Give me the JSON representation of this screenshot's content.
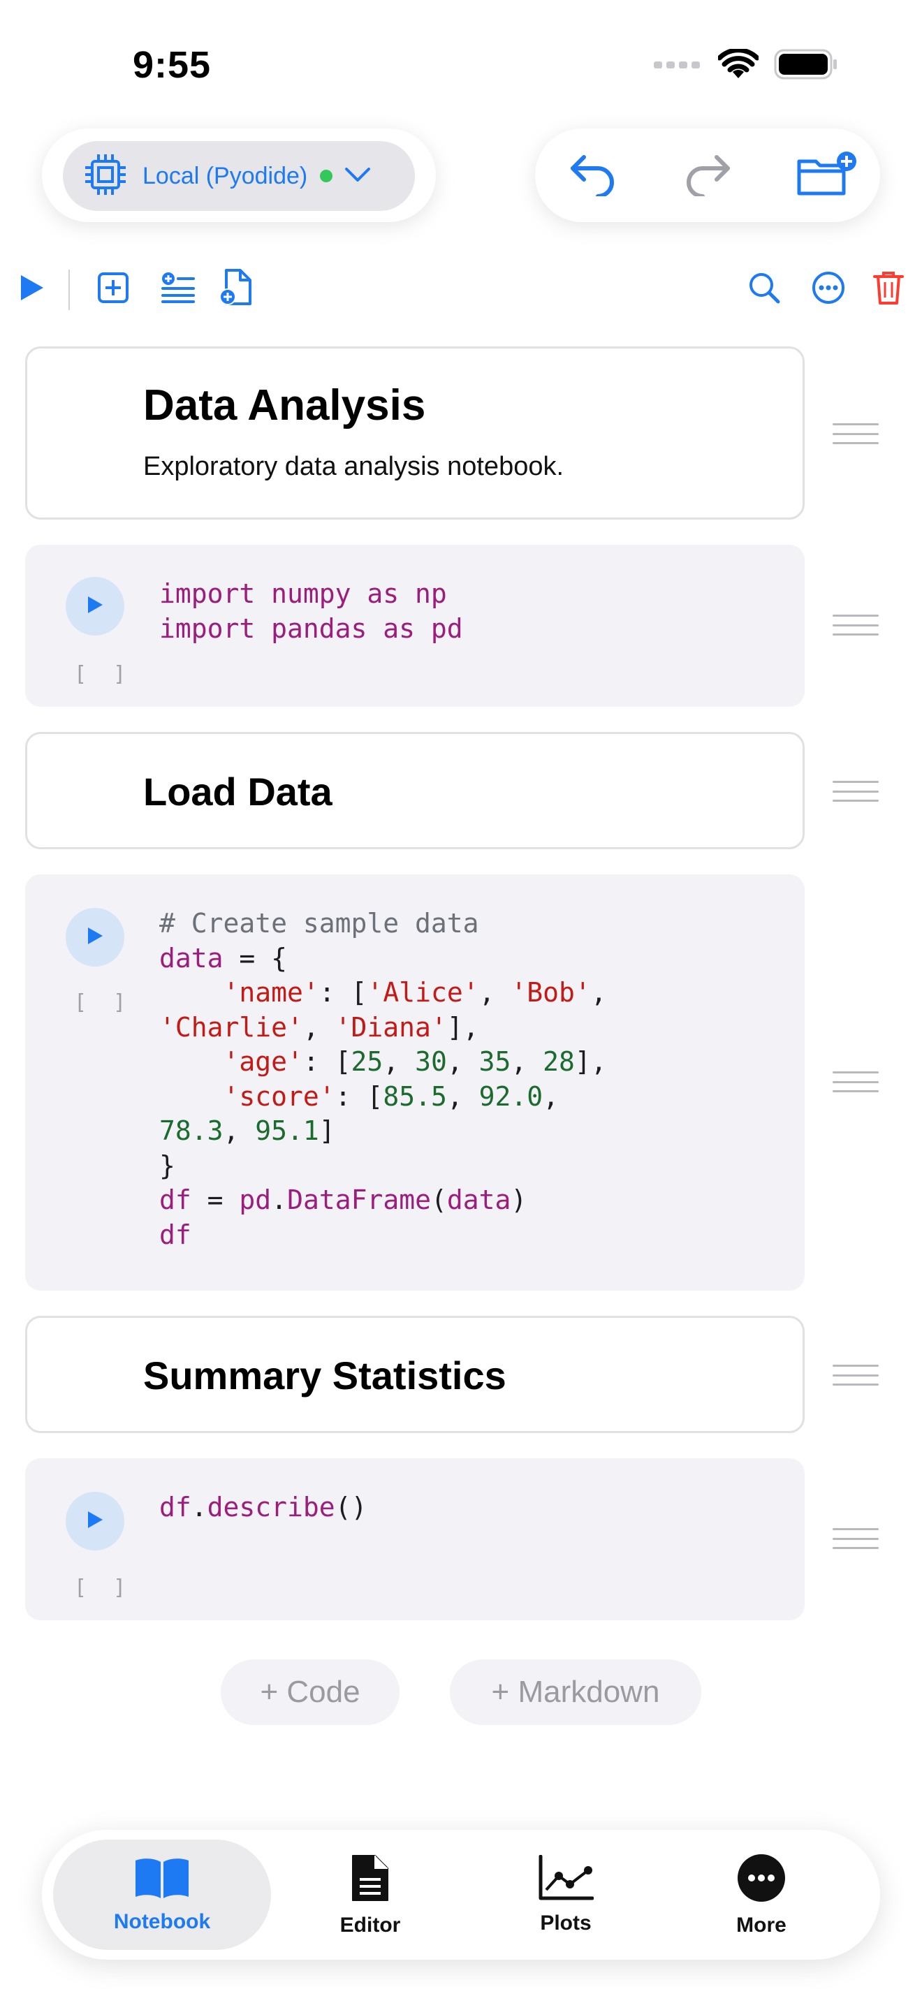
{
  "status": {
    "time": "9:55"
  },
  "kernel": {
    "label": "Local (Pyodide)",
    "status_color": "#34c759"
  },
  "nav": {
    "icons": [
      "undo-icon",
      "redo-icon",
      "new-folder-icon"
    ]
  },
  "toolbar": {
    "icons": [
      "run-all-icon",
      "add-code-cell-icon",
      "add-markdown-cell-icon",
      "new-notebook-icon",
      "search-icon",
      "more-options-icon",
      "delete-icon"
    ]
  },
  "cells": [
    {
      "type": "markdown",
      "heading": "Data Analysis",
      "paragraph": "Exploratory data analysis notebook."
    },
    {
      "type": "code",
      "exec": "[ ]",
      "lines": [
        "import numpy as np",
        "import pandas as pd"
      ]
    },
    {
      "type": "markdown",
      "heading": "Load Data"
    },
    {
      "type": "code",
      "exec": "[ ]",
      "lines": [
        "# Create sample data",
        "data = {",
        "    'name': ['Alice', 'Bob',",
        "'Charlie', 'Diana'],",
        "    'age': [25, 30, 35, 28],",
        "    'score': [85.5, 92.0,",
        "78.3, 95.1]",
        "}",
        "df = pd.DataFrame(data)",
        "df"
      ]
    },
    {
      "type": "markdown",
      "heading": "Summary Statistics"
    },
    {
      "type": "code",
      "exec": "[ ]",
      "lines": [
        "df.describe()"
      ]
    }
  ],
  "add_buttons": {
    "code": "+ Code",
    "markdown": "+ Markdown"
  },
  "tabs": [
    {
      "label": "Notebook",
      "icon": "book-icon",
      "active": true
    },
    {
      "label": "Editor",
      "icon": "document-icon",
      "active": false
    },
    {
      "label": "Plots",
      "icon": "chart-icon",
      "active": false
    },
    {
      "label": "More",
      "icon": "ellipsis-circle-icon",
      "active": false
    }
  ],
  "colors": {
    "accent": "#1d7af3",
    "delete": "#ff3b30",
    "keyword": "#9b1d7c",
    "string": "#c41a16",
    "number": "#1c6b2e",
    "comment": "#6c7079"
  }
}
